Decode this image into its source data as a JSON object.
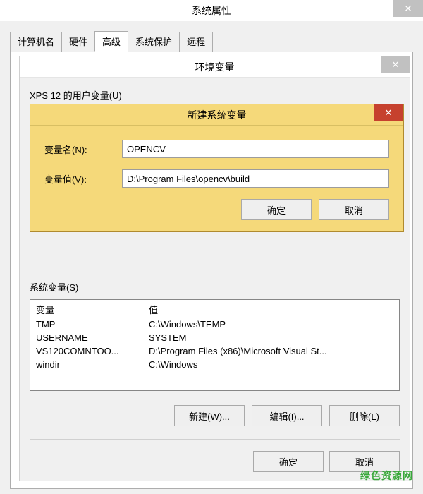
{
  "outer": {
    "title": "系统属性"
  },
  "tabs": {
    "items": [
      "计算机名",
      "硬件",
      "高级",
      "系统保护",
      "远程"
    ],
    "active_index": 2
  },
  "env": {
    "title": "环境变量",
    "user_vars_header": "XPS 12 的用户变量(U)",
    "sysvars_label": "系统变量(S)",
    "columns": {
      "name": "变量",
      "value": "值"
    },
    "rows": [
      {
        "name": "TMP",
        "value": "C:\\Windows\\TEMP"
      },
      {
        "name": "USERNAME",
        "value": "SYSTEM"
      },
      {
        "name": "VS120COMNTOO...",
        "value": "D:\\Program Files (x86)\\Microsoft Visual St..."
      },
      {
        "name": "windir",
        "value": "C:\\Windows"
      }
    ],
    "buttons": {
      "new": "新建(W)...",
      "edit": "编辑(I)...",
      "delete": "删除(L)"
    },
    "bottom": {
      "ok": "确定",
      "cancel": "取消"
    }
  },
  "newvar": {
    "title": "新建系统变量",
    "name_label": "变量名(N):",
    "value_label": "变量值(V):",
    "name_value": "OPENCV",
    "value_value": "D:\\Program Files\\opencv\\build",
    "ok": "确定",
    "cancel": "取消"
  },
  "watermark": "绿色资源网"
}
